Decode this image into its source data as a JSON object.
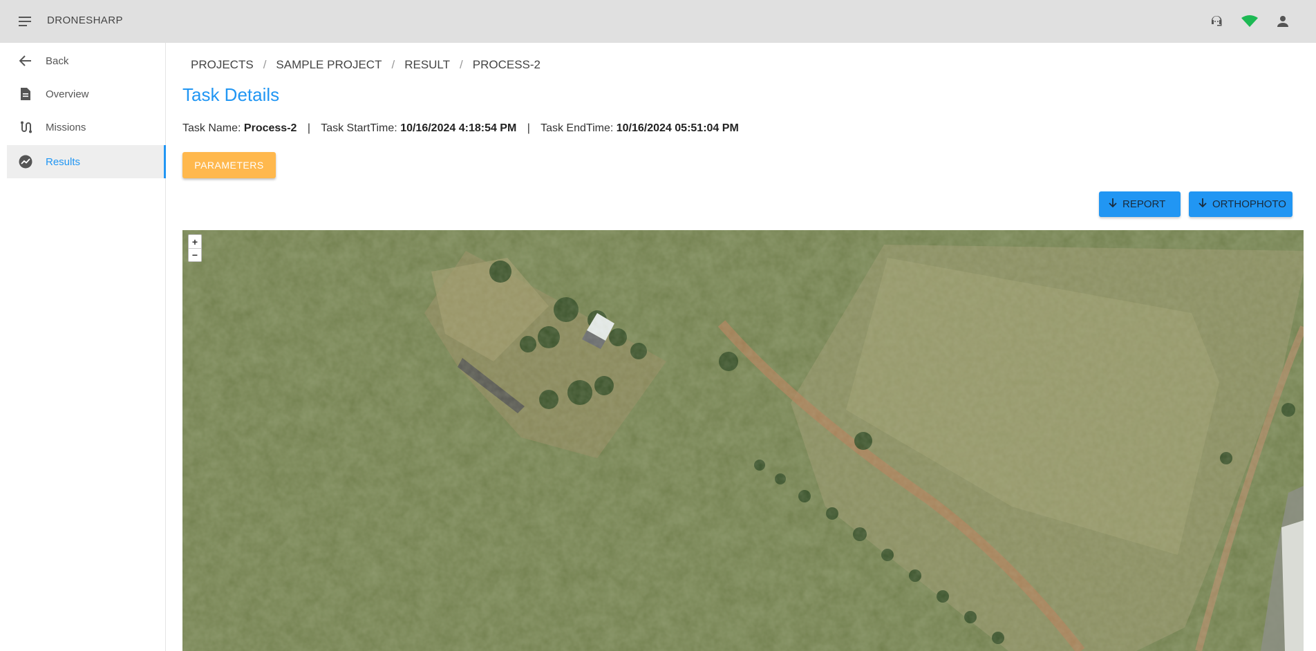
{
  "app": {
    "title": "DRONESHARP"
  },
  "topbar": {
    "icons": [
      "support-agent-icon",
      "wifi-signal-icon",
      "account-icon"
    ],
    "signal_color": "#1db954"
  },
  "sidebar": {
    "items": [
      {
        "label": "Back",
        "icon": "arrow-left-icon"
      },
      {
        "label": "Overview",
        "icon": "document-icon"
      },
      {
        "label": "Missions",
        "icon": "route-icon"
      },
      {
        "label": "Results",
        "icon": "chart-icon",
        "active": true
      }
    ]
  },
  "breadcrumb": [
    "PROJECTS",
    "SAMPLE PROJECT",
    "RESULT",
    "PROCESS-2"
  ],
  "breadcrumb_separator": "/",
  "page": {
    "title": "Task Details",
    "task_name_label": "Task Name:",
    "task_name": "Process-2",
    "start_label": "Task StartTime:",
    "start_time": "10/16/2024 4:18:54 PM",
    "end_label": "Task EndTime:",
    "end_time": "10/16/2024 05:51:04 PM",
    "divider": "|"
  },
  "buttons": {
    "parameters": "PARAMETERS",
    "report": "REPORT",
    "orthophoto": "ORTHOPHOTO"
  },
  "map": {
    "zoom_in": "+",
    "zoom_out": "−"
  },
  "colors": {
    "accent": "#2196f3",
    "warning": "#ffb84d",
    "appbar": "#e0e0e0"
  }
}
